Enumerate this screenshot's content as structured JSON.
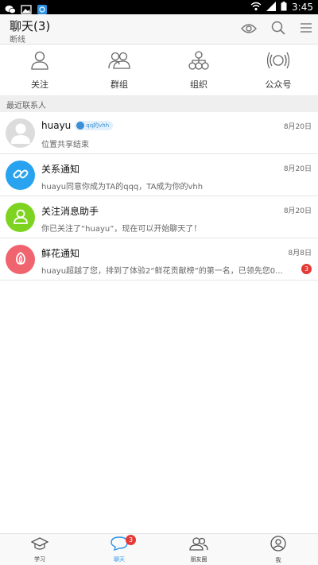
{
  "statusbar": {
    "time": "3:45"
  },
  "header": {
    "title": "聊天(3)",
    "subtitle": "断线"
  },
  "quicknav": [
    {
      "label": "关注",
      "icon": "person-icon"
    },
    {
      "label": "群组",
      "icon": "group-icon"
    },
    {
      "label": "组织",
      "icon": "org-icon"
    },
    {
      "label": "公众号",
      "icon": "broadcast-icon"
    }
  ],
  "section_label": "最近联系人",
  "conversations": [
    {
      "name": "huayu",
      "tag": "qq的vhh",
      "date": "8月20日",
      "preview": "位置共享结束",
      "avatar_color": "#dddddd",
      "icon": "default-avatar-icon"
    },
    {
      "name": "关系通知",
      "date": "8月20日",
      "preview": "huayu同意你成为TA的qqq，TA成为你的vhh",
      "avatar_color": "#29a3ef",
      "icon": "link-icon"
    },
    {
      "name": "关注消息助手",
      "date": "8月20日",
      "preview": "你已关注了“huayu”，现在可以开始聊天了！",
      "avatar_color": "#7ed321",
      "icon": "person-icon"
    },
    {
      "name": "鲜花通知",
      "date": "8月8日",
      "preview": "huayu超越了您，排到了体验2“鲜花贡献榜”的第一名，已领先您0...",
      "avatar_color": "#f06470",
      "icon": "flower-icon",
      "badge": "3"
    }
  ],
  "tabs": [
    {
      "label": "学习",
      "icon": "graduation-cap-icon"
    },
    {
      "label": "聊天",
      "icon": "chat-bubble-icon",
      "badge": "3",
      "active": true
    },
    {
      "label": "朋友圈",
      "icon": "friends-icon"
    },
    {
      "label": "我",
      "icon": "profile-icon"
    }
  ],
  "colors": {
    "accent": "#2b92e4",
    "badge": "#e53935"
  }
}
